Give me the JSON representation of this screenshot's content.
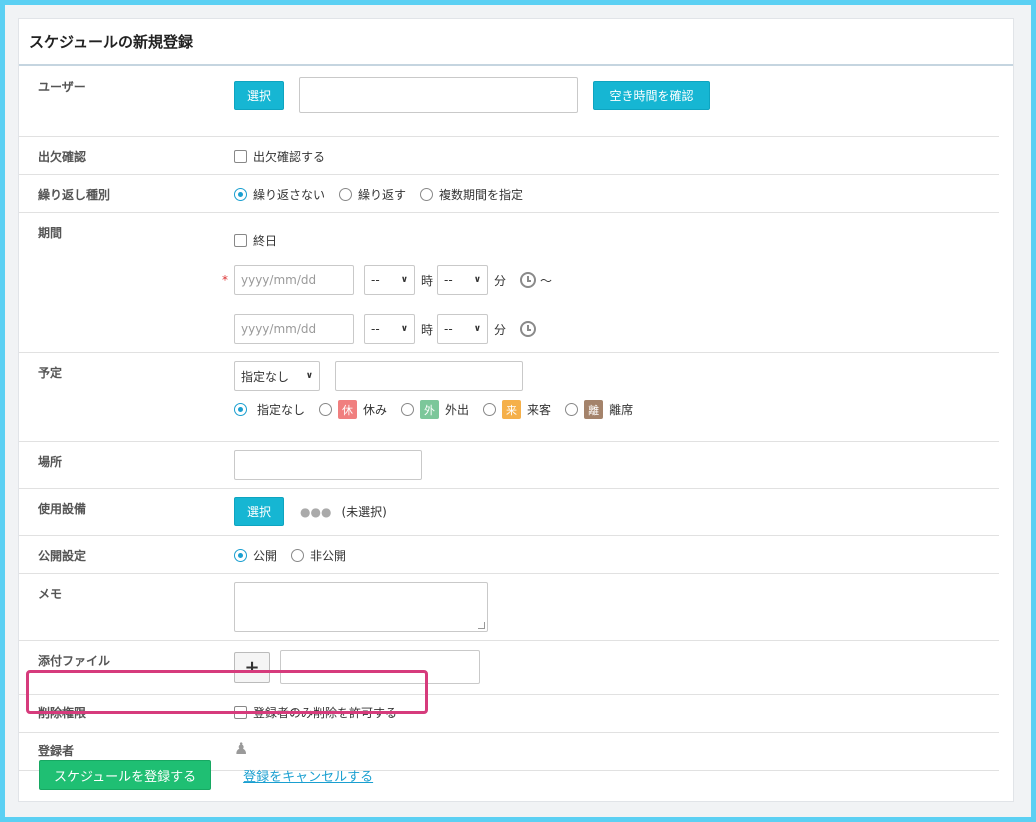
{
  "form": {
    "title": "スケジュールの新規登録"
  },
  "user": {
    "label": "ユーザー",
    "select_button": "選択",
    "input_value": "",
    "check_free_button": "空き時間を確認"
  },
  "attendance": {
    "label": "出欠確認",
    "checkbox_label": "出欠確認する"
  },
  "repeat": {
    "label": "繰り返し種別",
    "options": [
      "繰り返さない",
      "繰り返す",
      "複数期間を指定"
    ],
    "selected": "繰り返さない"
  },
  "period": {
    "label": "期間",
    "allday_label": "終日",
    "required_mark": "*",
    "date_placeholder": "yyyy/mm/dd",
    "hour_value": "--",
    "minute_value": "--",
    "hour_unit": "時",
    "minute_unit": "分",
    "range_sep": "～"
  },
  "plan": {
    "label": "予定",
    "type_select": "指定なし",
    "options": [
      {
        "label": "指定なし",
        "tag": "",
        "color": ""
      },
      {
        "label": "休み",
        "tag": "休",
        "color": "#f07f7f"
      },
      {
        "label": "外出",
        "tag": "外",
        "color": "#7cc79a"
      },
      {
        "label": "来客",
        "tag": "来",
        "color": "#f5b04a"
      },
      {
        "label": "離席",
        "tag": "離",
        "color": "#a4836b"
      }
    ],
    "selected": "指定なし"
  },
  "place": {
    "label": "場所"
  },
  "equipment": {
    "label": "使用設備",
    "select_button": "選択",
    "status": "(未選択)"
  },
  "publish": {
    "label": "公開設定",
    "options": [
      "公開",
      "非公開"
    ],
    "selected": "公開"
  },
  "memo": {
    "label": "メモ"
  },
  "attachment": {
    "label": "添付ファイル",
    "add_label": "+"
  },
  "delete_permission": {
    "label": "削除権限",
    "checkbox_label": "登録者のみ削除を許可する"
  },
  "registrant": {
    "label": "登録者"
  },
  "actions": {
    "submit": "スケジュールを登録する",
    "cancel": "登録をキャンセルする"
  },
  "colors": {
    "accent_teal": "#16b6d3",
    "submit_green": "#1fbf73",
    "highlight": "#d63b7c",
    "frame": "#5bd0f3"
  }
}
